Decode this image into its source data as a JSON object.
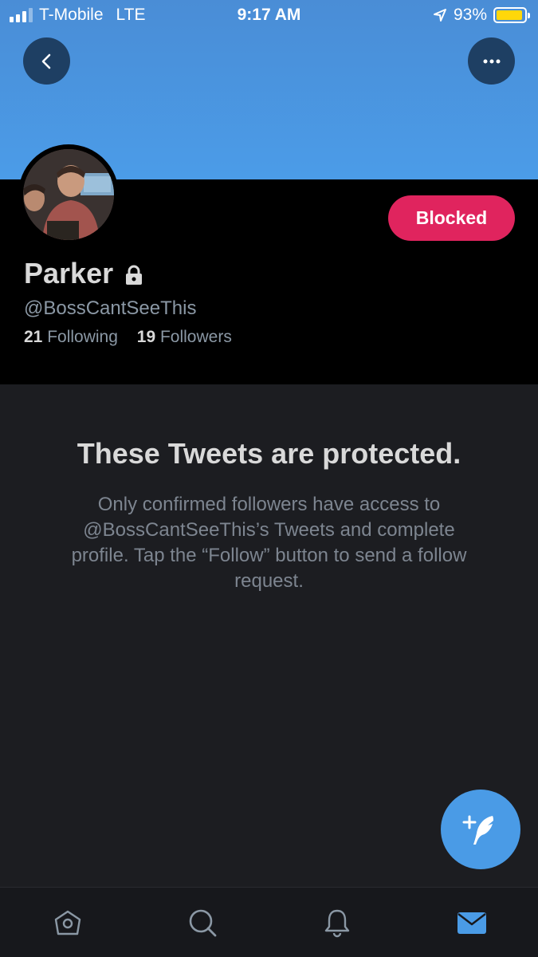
{
  "status_bar": {
    "carrier": "T-Mobile",
    "network": "LTE",
    "time": "9:17 AM",
    "battery_percent": "93%",
    "battery_level": 0.93
  },
  "profile": {
    "name": "Parker",
    "handle": "@BossCantSeeThis",
    "following_count": "21",
    "following_label": "Following",
    "followers_count": "19",
    "followers_label": "Followers",
    "blocked_label": "Blocked"
  },
  "protected": {
    "title": "These Tweets are protected.",
    "description": "Only confirmed followers have access to @BossCantSeeThis’s Tweets and complete profile. Tap the “Follow” button to send a follow request."
  },
  "icons": {
    "back": "chevron-left-icon",
    "more": "more-horizontal-icon",
    "lock": "lock-icon",
    "compose": "compose-tweet-icon",
    "home": "home-icon",
    "search": "search-icon",
    "notifications": "bell-icon",
    "messages": "mail-icon"
  },
  "colors": {
    "accent": "#4a9be6",
    "blocked": "#e0245e",
    "banner": "#4b9ce8"
  }
}
